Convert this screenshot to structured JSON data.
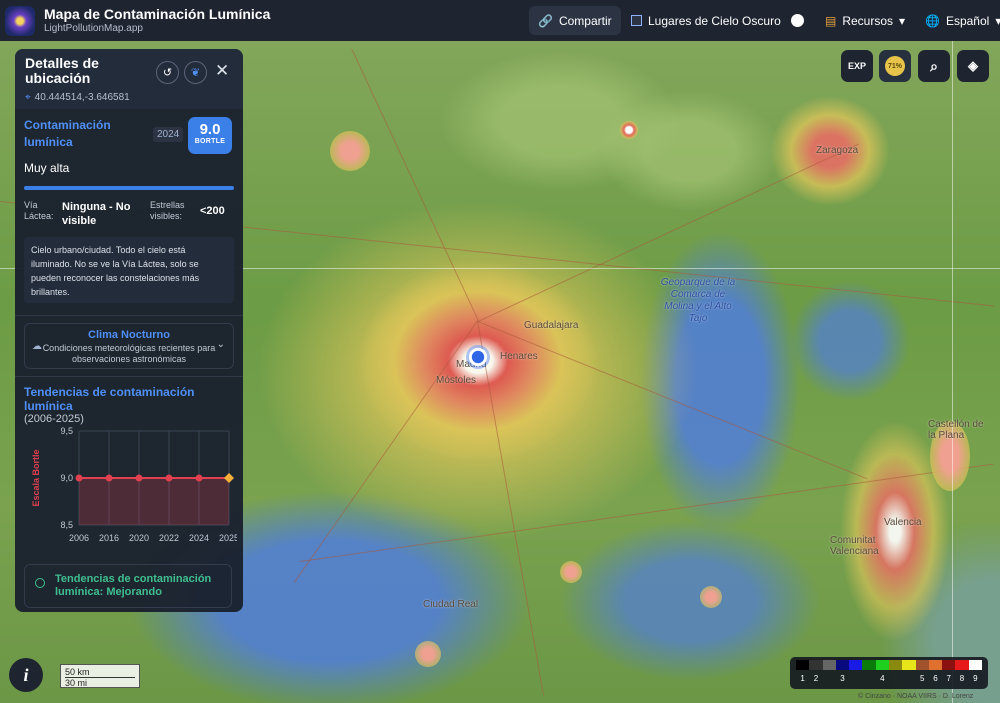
{
  "app": {
    "title": "Mapa de Contaminación Lumínica",
    "subtitle": "LightPollutionMap.app"
  },
  "topbar": {
    "share_label": "Compartir",
    "dark_sites_label": "Lugares de Cielo Oscuro",
    "resources_label": "Recursos",
    "language_label": "Español"
  },
  "controls": {
    "exp_label": "EXP",
    "moon_label": "71%"
  },
  "map": {
    "labels": [
      "Zaragoza",
      "Valencia",
      "Guadalajara",
      "Madrid",
      "Móstoles",
      "Henares",
      "Castellón de la Plana",
      "Ciudad Real",
      "Comunitat Valenciana"
    ],
    "geopark_label": "Geoparque de la Comarca de Molina y el Alto Tajo",
    "scale_km": "50 km",
    "scale_mi": "30 mi",
    "attribution": "© Cinzano · NOAA VIIRS · D. Lorenz"
  },
  "panel": {
    "title": "Detalles de ubicación",
    "coords": "40.444514,-3.646581",
    "lp_title": "Contaminación lumínica",
    "year": "2024",
    "bortle_value": "9.0",
    "bortle_label": "BORTLE",
    "level": "Muy alta",
    "milky_way_key": "Vía Láctea:",
    "milky_way_value": "Ninguna - No visible",
    "stars_key": "Estrellas visibles:",
    "stars_value": "<200",
    "description": "Cielo urbano/ciudad. Todo el cielo está iluminado. No se ve la Vía Láctea, solo se pueden reconocer las constelaciones más brillantes.",
    "weather_title": "Clima Nocturno",
    "weather_sub": "Condiciones meteorológicas recientes para observaciones astronómicas",
    "trend_title": "Tendencias de contaminación lumínica",
    "trend_years": "(2006-2025)",
    "status": "Tendencias de contaminación lumínica: Mejorando"
  },
  "legend": {
    "colors": [
      "#000000",
      "#333333",
      "#666666",
      "#0a0a80",
      "#1a1ae6",
      "#0a7a0a",
      "#1ecf1e",
      "#8a8a10",
      "#e6e61a",
      "#a0522d",
      "#e07030",
      "#8b1010",
      "#e61a1a",
      "#ffffff"
    ],
    "labels": [
      "1",
      "2",
      "",
      "3",
      "",
      "",
      "4",
      "",
      "",
      "5",
      "6",
      "7",
      "8",
      "9"
    ]
  },
  "chart_data": {
    "type": "line",
    "categories": [
      "2006",
      "2016",
      "2020",
      "2022",
      "2024",
      "2025"
    ],
    "series": [
      {
        "values": [
          9.0,
          9.0,
          9.0,
          9.0,
          9.0,
          9.0
        ]
      }
    ],
    "ylabel": "Escala Bortle",
    "ylim": [
      8.5,
      9.5
    ],
    "yticks": [
      "9,5",
      "9,0",
      "8,5"
    ],
    "highlight_last": true,
    "line_color": "#e04050",
    "last_point_color": "#f2b03a"
  }
}
